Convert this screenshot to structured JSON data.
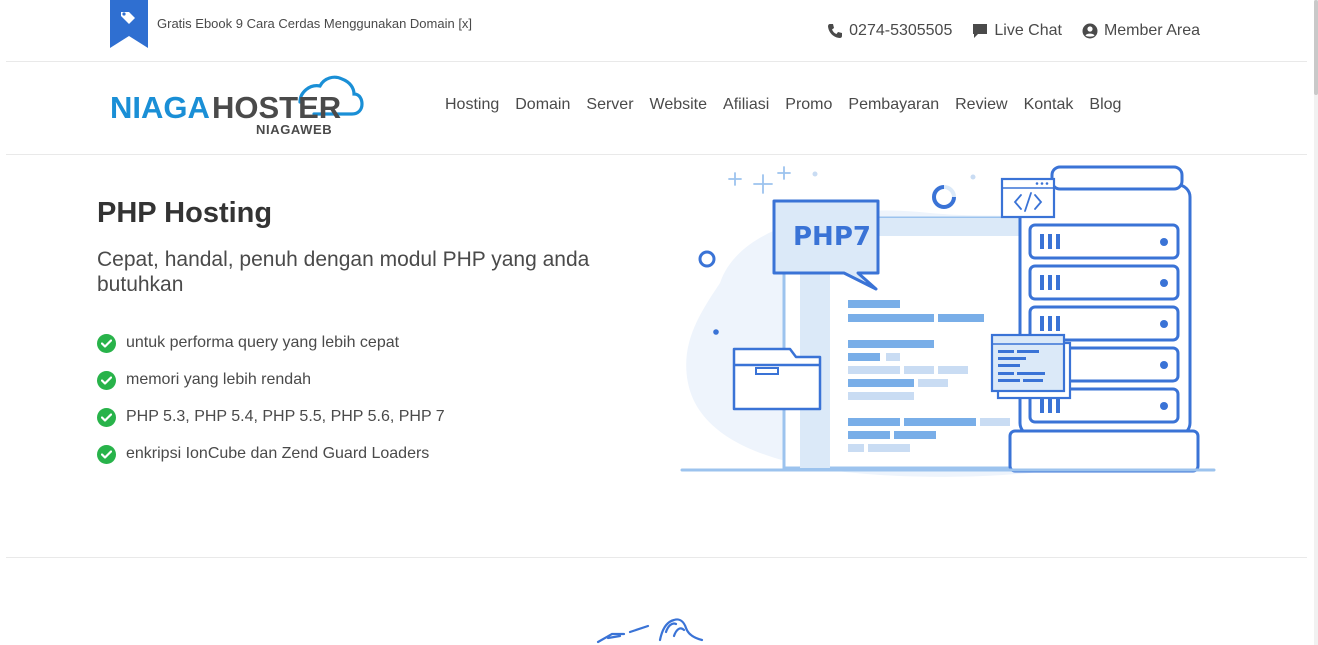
{
  "topbar": {
    "promo_icon": "tag-icon",
    "promo_text": "Gratis Ebook 9 Cara Cerdas Menggunakan Domain [x]",
    "phone_icon": "phone-icon",
    "phone": "0274-5305505",
    "chat_icon": "chat-bubble-icon",
    "chat_label": "Live Chat",
    "member_icon": "user-circle-icon",
    "member_label": "Member Area"
  },
  "brand": {
    "logo_text_primary": "NIAGA",
    "logo_text_secondary": "HOSTER",
    "logo_subtext": "NIAGAWEB",
    "color_primary": "#1a8fd6",
    "color_secondary": "#4a4a4a"
  },
  "nav": {
    "items": [
      "Hosting",
      "Domain",
      "Server",
      "Website",
      "Afiliasi",
      "Promo",
      "Pembayaran",
      "Review",
      "Kontak",
      "Blog"
    ]
  },
  "hero": {
    "title": "PHP Hosting",
    "subtitle": "Cepat, handal, penuh dengan modul PHP yang anda butuhkan",
    "features": [
      "untuk performa query yang lebih cepat",
      "memori yang lebih rendah",
      "PHP 5.3, PHP 5.4, PHP 5.5, PHP 5.6, PHP 7",
      "enkripsi IonCube dan Zend Guard Loaders"
    ],
    "check_color": "#28b34a",
    "illustration_label": "PHP7"
  },
  "colors": {
    "illustration_blue": "#3a73d6",
    "illustration_light": "#dbe9f8"
  }
}
